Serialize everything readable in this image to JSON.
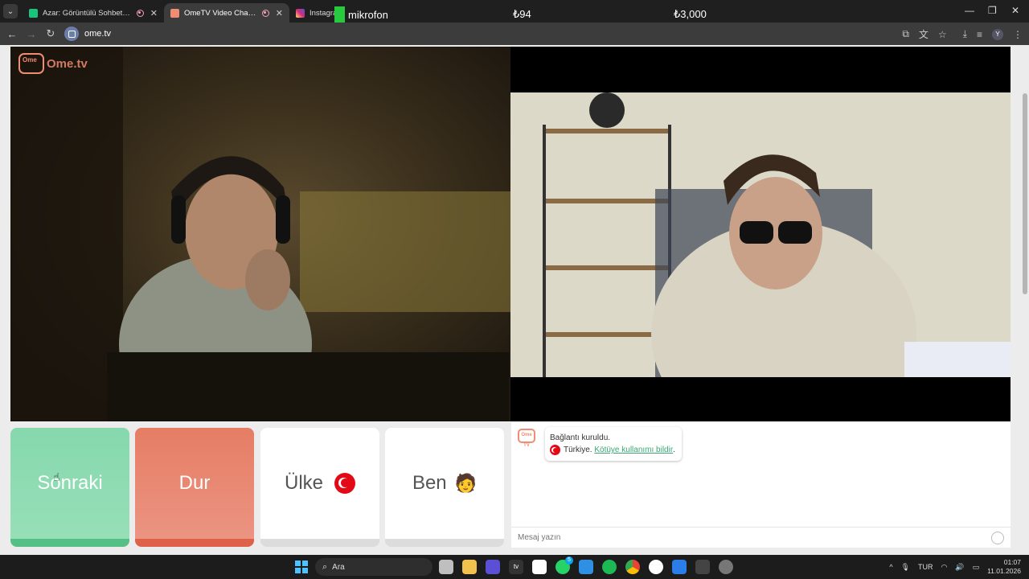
{
  "browser": {
    "tabs": [
      {
        "title": "Azar: Görüntülü Sohbet & V",
        "favicon_color": "#1bc47d",
        "recording": true,
        "active": false
      },
      {
        "title": "OmeTV Video Chat — Ome",
        "favicon_color": "#f08c73",
        "recording": true,
        "active": true
      },
      {
        "title": "Instagram",
        "favicon_color": "#d62976",
        "recording": false,
        "active": false
      }
    ],
    "overlay": {
      "mic_label": "mikrofon",
      "value_a": "₺94",
      "value_b": "₺3,000"
    },
    "url": "ome.tv"
  },
  "page": {
    "logo_text": "Ome.tv",
    "buttons": {
      "next": "Sonraki",
      "stop": "Dur",
      "country": "Ülke",
      "me": "Ben"
    },
    "chat": {
      "logo_label": "Ome TV",
      "message_line1": "Bağlantı kuruldu.",
      "country": "Türkiye.",
      "report_link": "Kötüye kullanımı bildir",
      "report_suffix": ".",
      "input_placeholder": "Mesaj yazın"
    }
  },
  "taskbar": {
    "search_label": "Ara",
    "language": "TUR",
    "time": "01:07",
    "date": "11.01.2026",
    "whatsapp_badge": "5"
  },
  "colors": {
    "next_green": "#55c086",
    "stop_red": "#dd6249",
    "brand_orange": "#f08c73",
    "link_green": "#3aa675"
  }
}
